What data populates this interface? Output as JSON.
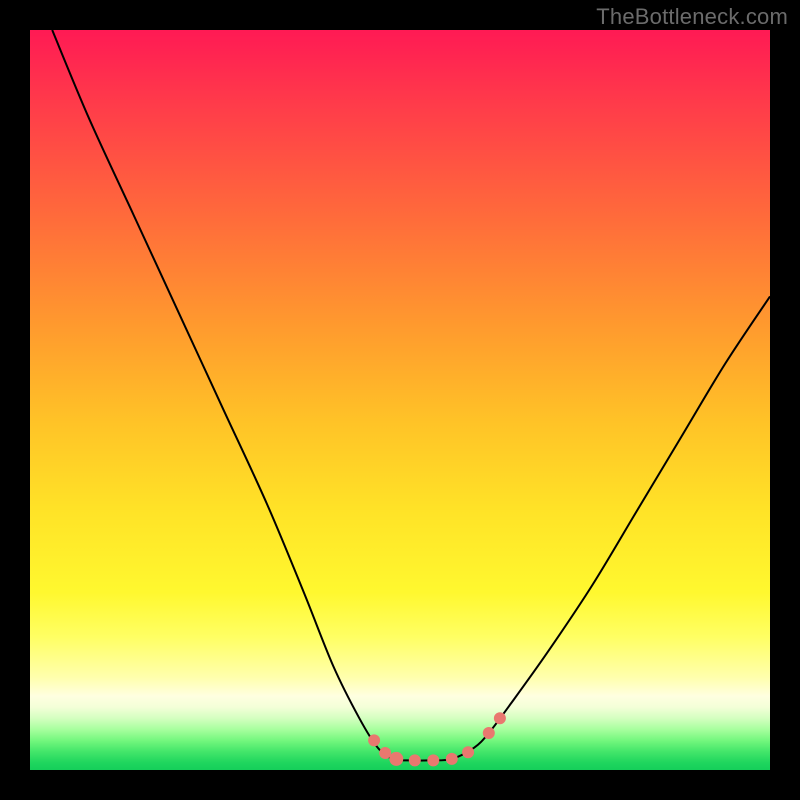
{
  "watermark": "TheBottleneck.com",
  "chart_data": {
    "type": "line",
    "title": "",
    "xlabel": "",
    "ylabel": "",
    "xlim": [
      0,
      100
    ],
    "ylim": [
      0,
      100
    ],
    "grid": false,
    "legend": false,
    "series": [
      {
        "name": "bottleneck-curve",
        "x": [
          3,
          8,
          14,
          20,
          26,
          32,
          37,
          41,
          44.5,
          47,
          49,
          51,
          54,
          57,
          60,
          62,
          65,
          70,
          76,
          82,
          88,
          94,
          100
        ],
        "y": [
          100,
          88,
          75,
          62,
          49,
          36,
          24,
          14,
          7,
          3,
          1.5,
          1.3,
          1.3,
          1.5,
          3,
          5,
          9,
          16,
          25,
          35,
          45,
          55,
          64
        ]
      }
    ],
    "markers": {
      "name": "highlight-markers",
      "points": [
        {
          "x": 46.5,
          "y": 4.0,
          "r": 6
        },
        {
          "x": 48.0,
          "y": 2.3,
          "r": 6
        },
        {
          "x": 49.5,
          "y": 1.5,
          "r": 7
        },
        {
          "x": 52.0,
          "y": 1.3,
          "r": 6
        },
        {
          "x": 54.5,
          "y": 1.3,
          "r": 6
        },
        {
          "x": 57.0,
          "y": 1.5,
          "r": 6
        },
        {
          "x": 59.2,
          "y": 2.4,
          "r": 6
        },
        {
          "x": 62.0,
          "y": 5.0,
          "r": 6
        },
        {
          "x": 63.5,
          "y": 7.0,
          "r": 6
        }
      ]
    },
    "background": {
      "type": "vertical-gradient",
      "stops": [
        {
          "pct": 0,
          "color": "#ff1a54"
        },
        {
          "pct": 25,
          "color": "#ff6a3b"
        },
        {
          "pct": 53,
          "color": "#ffc327"
        },
        {
          "pct": 76,
          "color": "#fff82f"
        },
        {
          "pct": 90,
          "color": "#ffffe0"
        },
        {
          "pct": 100,
          "color": "#15cf5a"
        }
      ]
    }
  }
}
